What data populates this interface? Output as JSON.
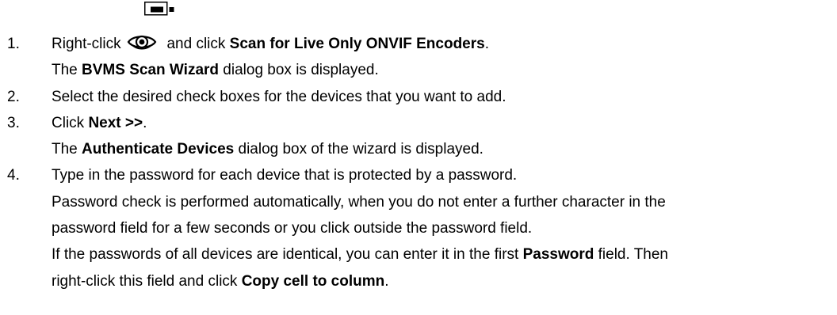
{
  "icons": {
    "device": "encoder-device-icon",
    "eye": "live-view-eye-icon"
  },
  "steps": [
    {
      "number": "1.",
      "line1": {
        "pre": "Right-click",
        "mid": "  and click ",
        "bold": "Scan for Live Only ONVIF Encoders",
        "post": "."
      },
      "line2": {
        "pre": "The ",
        "bold": "BVMS Scan Wizard",
        "post": " dialog box is displayed."
      }
    },
    {
      "number": "2.",
      "text": "Select the desired check boxes for the devices that you want to add."
    },
    {
      "number": "3.",
      "line1": {
        "pre": "Click ",
        "bold": "Next >>",
        "post": "."
      },
      "line2": {
        "pre": "The ",
        "bold": "Authenticate Devices",
        "post": " dialog box of the wizard is displayed."
      }
    },
    {
      "number": "4.",
      "line1": "Type in the password for each device that is protected by a password.",
      "line2": "Password check is performed automatically, when you do not enter a further character in the",
      "line3": "password field for a few seconds or you click outside the password field.",
      "line4": {
        "pre": "If the passwords of all devices are identical, you can enter it in the first ",
        "bold": "Password",
        "post": " field. Then"
      },
      "line5": {
        "pre": "right-click this field and click ",
        "bold": "Copy cell to column",
        "post": "."
      }
    }
  ]
}
